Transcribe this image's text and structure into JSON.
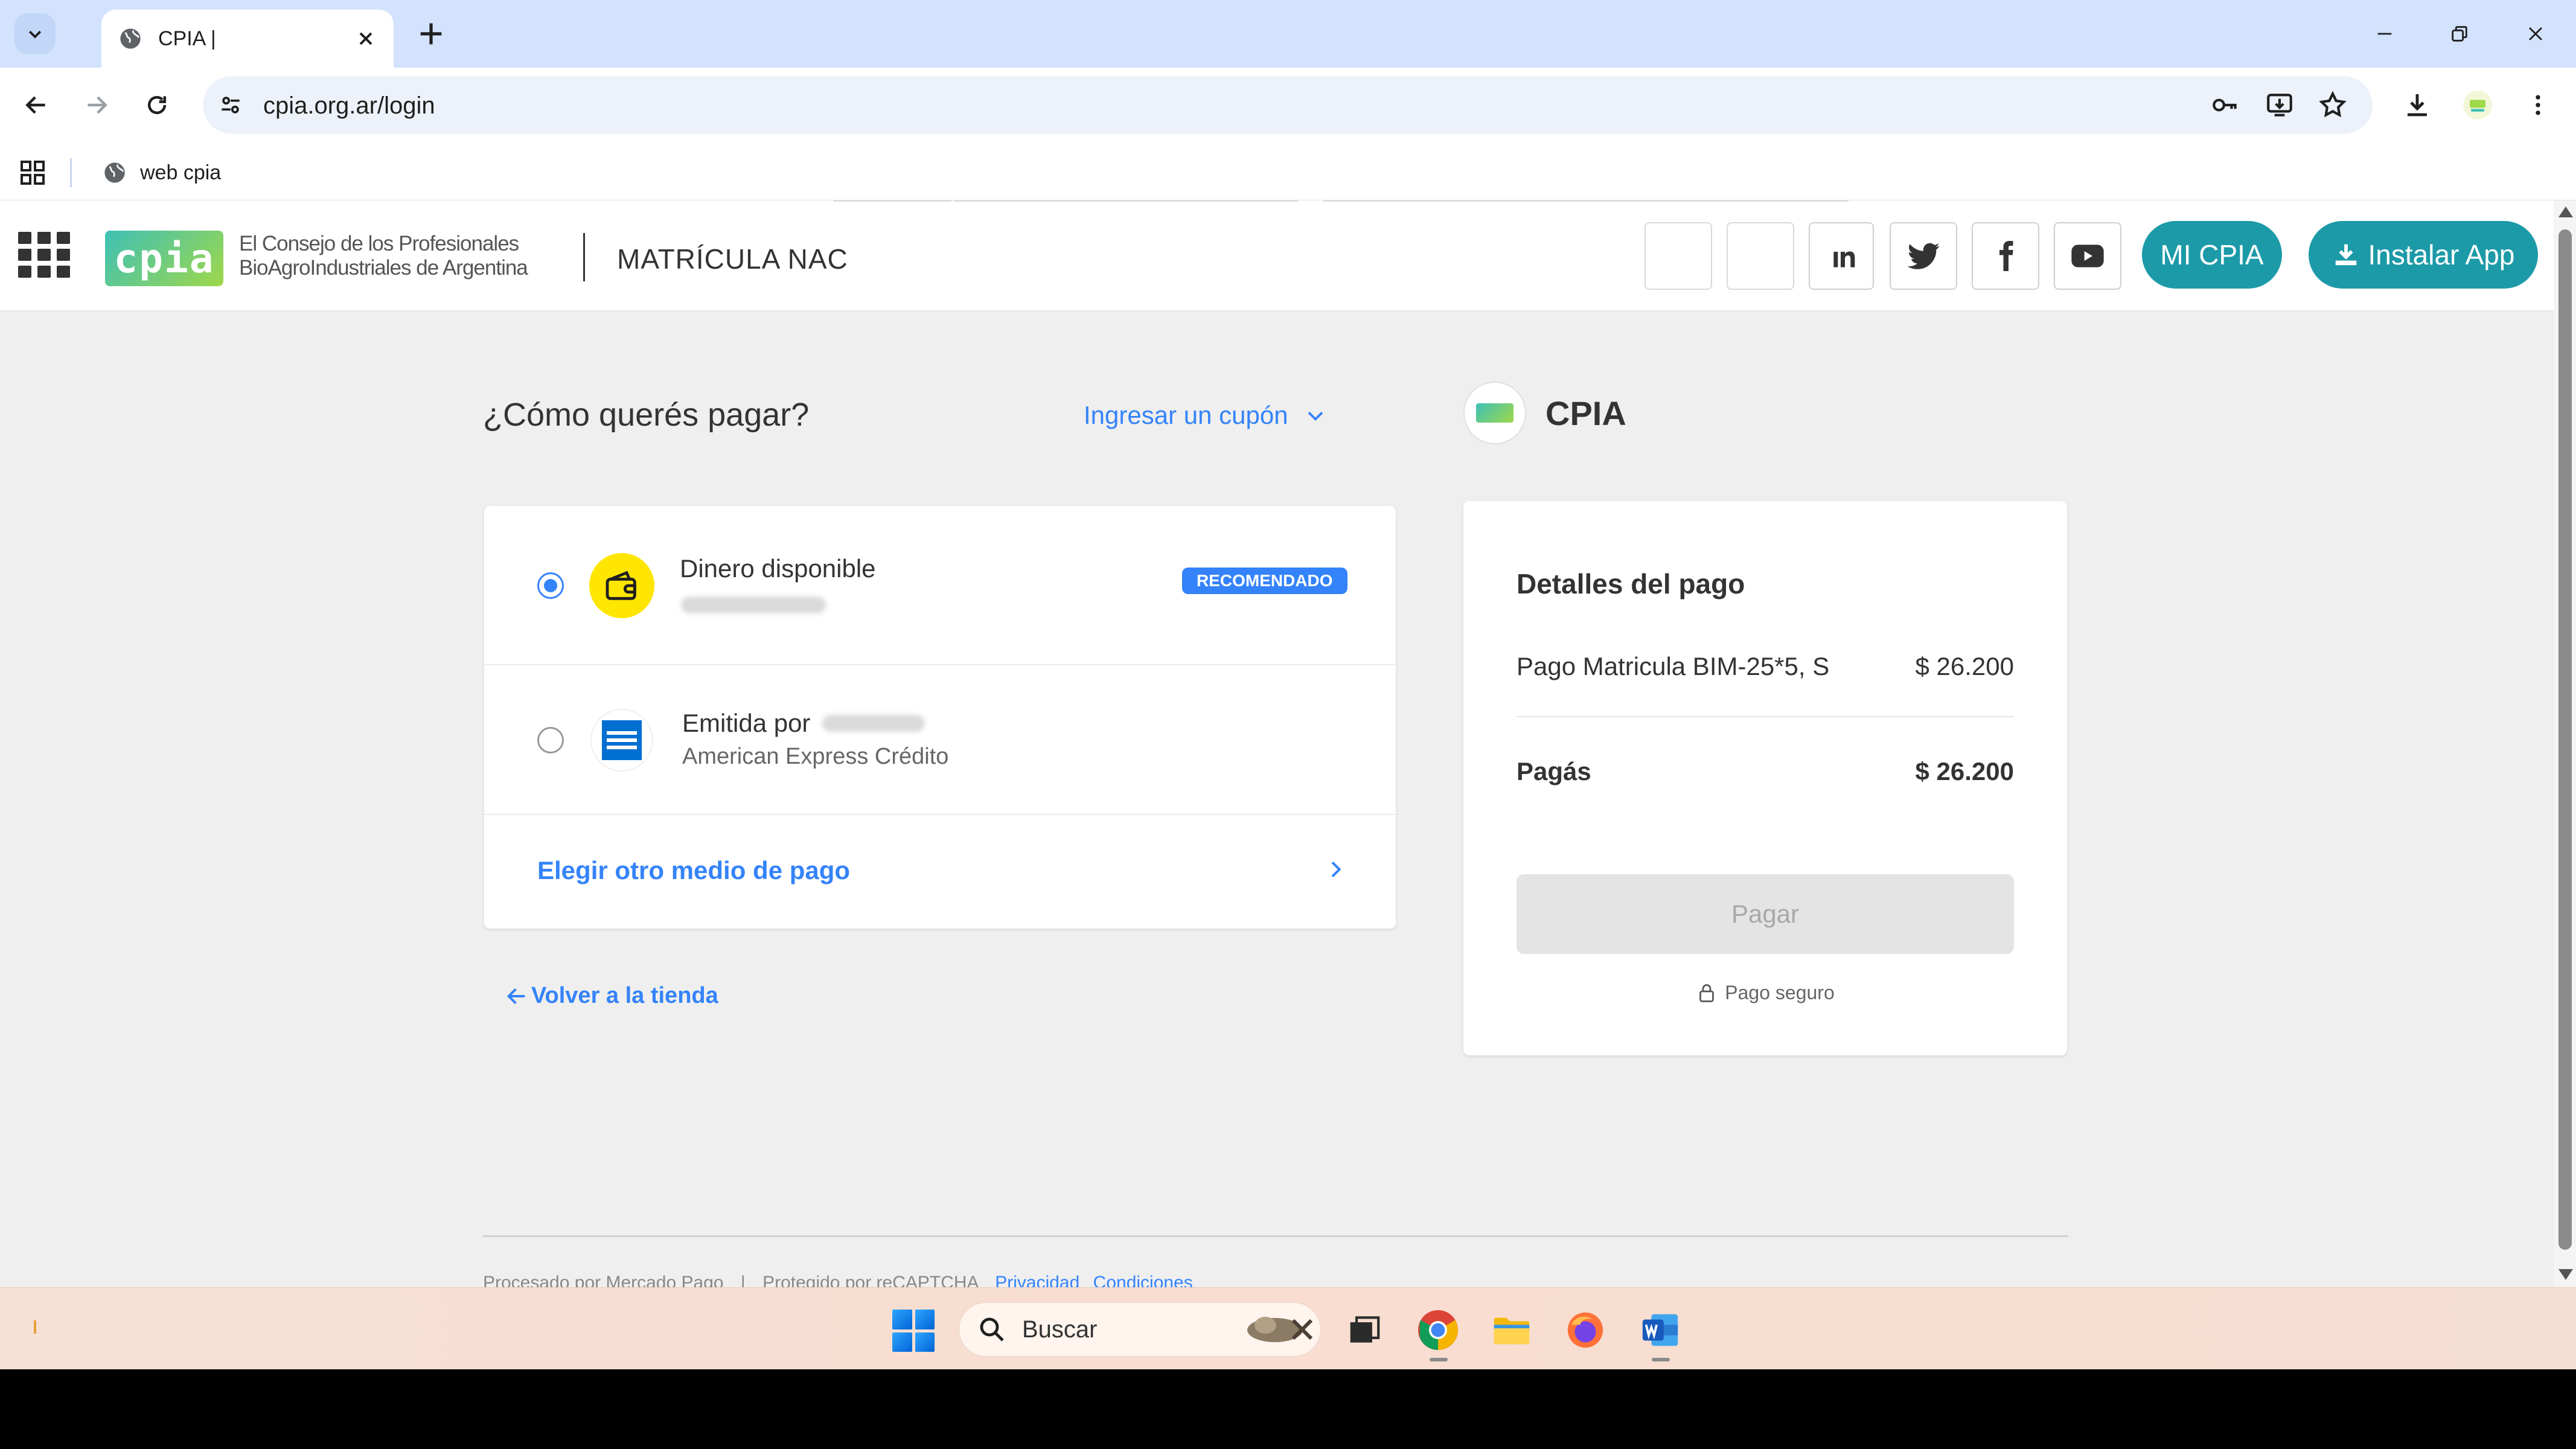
{
  "browser": {
    "tab_title": "CPIA |",
    "url": "cpia.org.ar/login",
    "bookmark_label": "web cpia",
    "icons": [
      "tab-search-icon",
      "globe-icon",
      "close-icon",
      "plus-icon",
      "minimize-icon",
      "restore-icon",
      "window-close-icon",
      "back-icon",
      "forward-icon",
      "reload-icon",
      "tune-icon",
      "key-icon",
      "install-icon",
      "star-icon",
      "download-icon",
      "profile-icon",
      "menu-dots-icon",
      "apps-grid-icon"
    ]
  },
  "site_header": {
    "logo_mark": "cpia",
    "logo_line1": "El Consejo de los Profesionales",
    "logo_line2": "BioAgroIndustriales de Argentina",
    "section_title": "MATRÍCULA NAC",
    "mi_cpia_label": "MI CPIA",
    "install_app_label": "Instalar App",
    "social_icons": [
      "linkedin-icon",
      "twitter-icon",
      "facebook-icon",
      "youtube-icon"
    ]
  },
  "checkout": {
    "question": "¿Cómo querés pagar?",
    "coupon_label": "Ingresar un cupón",
    "methods": [
      {
        "title": "Dinero disponible",
        "badge": "RECOMENDADO",
        "selected": true
      },
      {
        "title": "Emitida por",
        "subtitle": "American Express Crédito",
        "selected": false
      }
    ],
    "other_method_label": "Elegir otro medio de pago",
    "back_label": "Volver a la tienda"
  },
  "merchant": {
    "name": "CPIA"
  },
  "summary": {
    "title": "Detalles del pago",
    "item_label": "Pago Matricula BIM-25*5, S",
    "item_price": "$ 26.200",
    "total_label": "Pagás",
    "total_price": "$ 26.200",
    "pay_button": "Pagar",
    "secure_label": "Pago seguro"
  },
  "footer": {
    "processed_by": "Procesado por Mercado Pago",
    "separator": "|",
    "protected_by": "Protegido por reCAPTCHA",
    "privacy_link": "Privacidad",
    "terms_link": "Condiciones"
  },
  "taskbar": {
    "search_label": "Buscar",
    "apps": [
      "start-icon",
      "search-icon",
      "task-view-icon",
      "chrome-icon",
      "file-explorer-icon",
      "firefox-icon",
      "word-icon"
    ]
  },
  "colors": {
    "mp_blue": "#3483fa",
    "cpia_teal": "#1c9aa8",
    "wallet_yellow": "#ffe600",
    "amex_blue": "#016fd0",
    "page_bg": "#efefef",
    "tabstrip_bg": "#d3e3fd"
  }
}
